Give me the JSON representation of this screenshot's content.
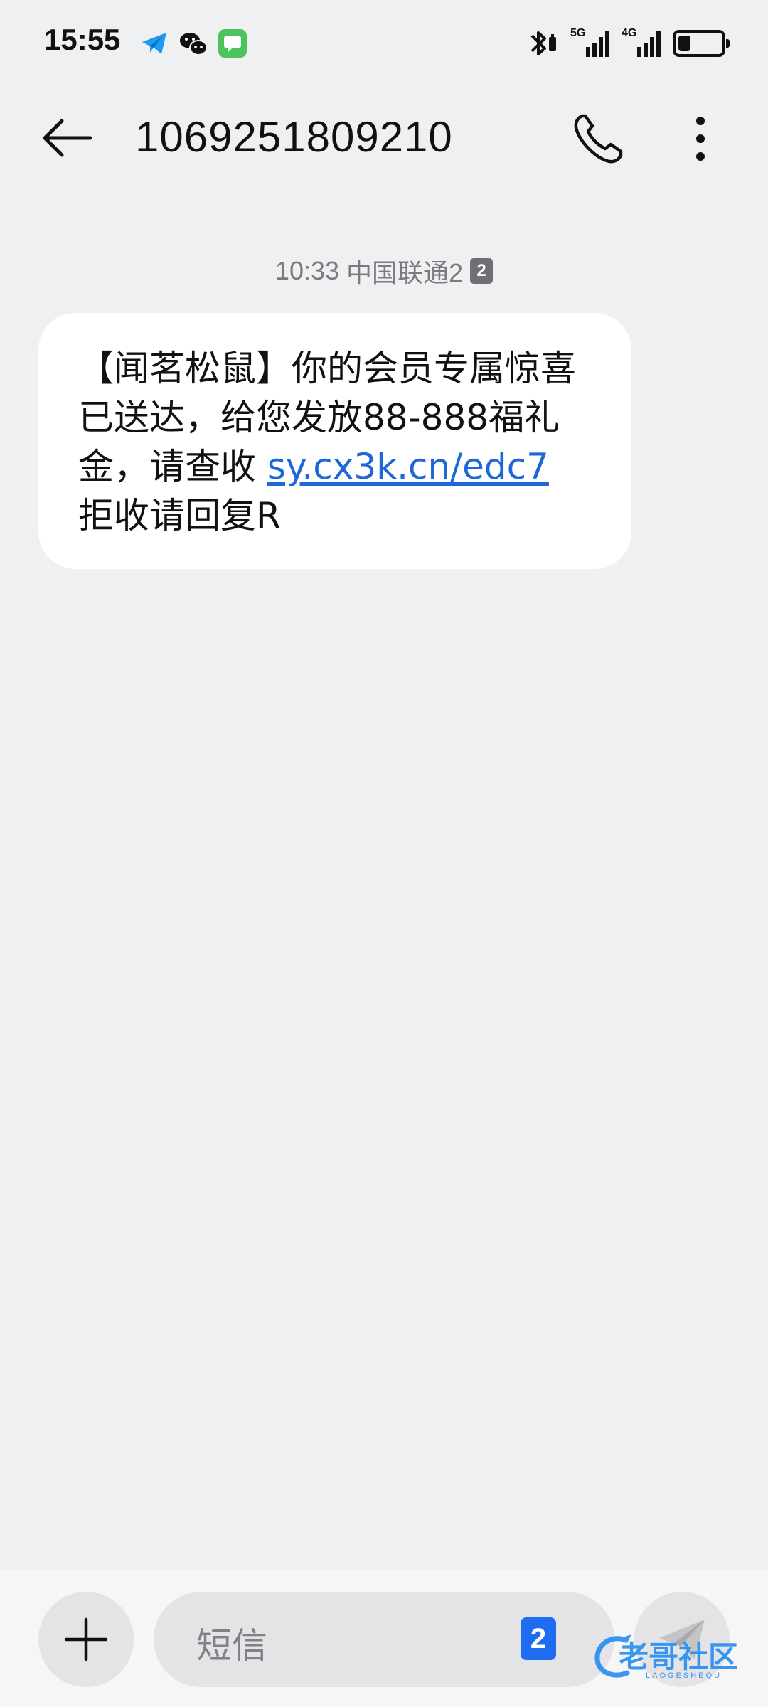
{
  "status_bar": {
    "time": "15:55",
    "notification_icons": [
      "telegram-icon",
      "wechat-icon",
      "messages-app-icon"
    ],
    "signal_1_label": "5G",
    "signal_2_label": "4G",
    "battery_level": 0.3
  },
  "header": {
    "title": "1069251809210",
    "back_icon": "arrow-left-icon",
    "call_icon": "phone-icon",
    "more_icon": "more-vertical-icon"
  },
  "message": {
    "time": "10:33",
    "carrier": "中国联通2",
    "sim_badge": "2",
    "text_part1": "【闻茗松鼠】你的会员专属惊喜已送达，给您发放88-888福礼金，请查收 ",
    "link": "sy.cx3k.cn/edc7",
    "text_part2": "拒收请回复R"
  },
  "composer": {
    "placeholder": "短信",
    "sim_badge": "2",
    "add_icon": "plus-icon",
    "send_icon": "send-icon"
  },
  "watermark": {
    "text": "老哥社区",
    "subtext": "LAOGESHEQU"
  },
  "colors": {
    "background": "#eff0f2",
    "bubble": "#ffffff",
    "link": "#1e67d6",
    "sim_badge_blue": "#1e6cf2",
    "watermark": "#2a8ff0"
  }
}
